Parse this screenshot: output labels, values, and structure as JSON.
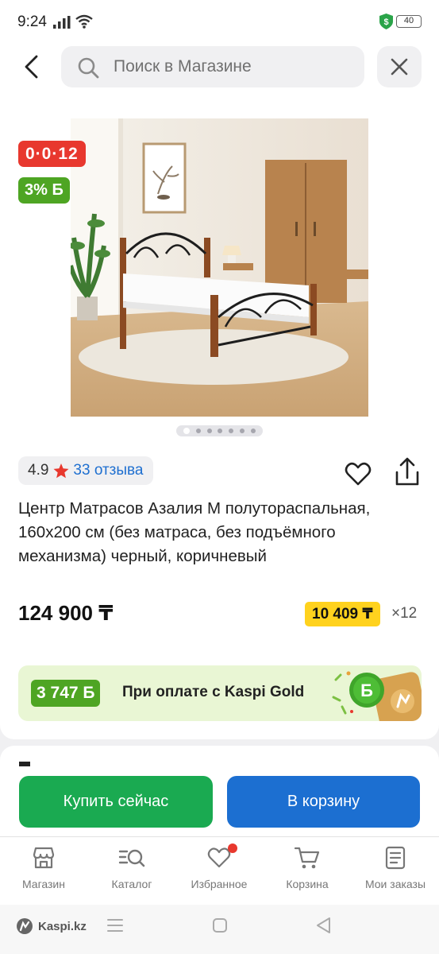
{
  "status_bar": {
    "time": "9:24",
    "battery": "40"
  },
  "search": {
    "placeholder": "Поиск в Магазине"
  },
  "product": {
    "promo_timer": "0·0·12",
    "bonus_badge": "3% Б",
    "rating": "4.9",
    "reviews": "33 отзыва",
    "title": "Центр Матрасов Азалия М полутораспальная, 160х200 см (без матраса, без подъёмного механизма) черный, коричневый",
    "price": "124 900 ₸",
    "installment_amount": "10 409 ₸",
    "installment_count": "×12",
    "image_count": 7,
    "active_image": 1
  },
  "kaspi_gold": {
    "bonus": "3 747 Б",
    "text": "При оплате с Kaspi Gold"
  },
  "actions": {
    "buy_now": "Купить сейчас",
    "add_to_cart": "В корзину"
  },
  "tabs": [
    {
      "label": "Магазин",
      "icon": "store-icon"
    },
    {
      "label": "Каталог",
      "icon": "catalog-icon"
    },
    {
      "label": "Избранное",
      "icon": "heart-icon"
    },
    {
      "label": "Корзина",
      "icon": "cart-icon"
    },
    {
      "label": "Мои заказы",
      "icon": "orders-icon"
    }
  ],
  "system_nav": {
    "brand": "Kaspi.kz"
  },
  "colors": {
    "promo_red": "#e8382e",
    "bonus_green": "#4ea523",
    "installment_yellow": "#ffd21e",
    "buy_green": "#1aaa51",
    "cart_blue": "#1c6fd1",
    "link_blue": "#1e6fd0"
  }
}
